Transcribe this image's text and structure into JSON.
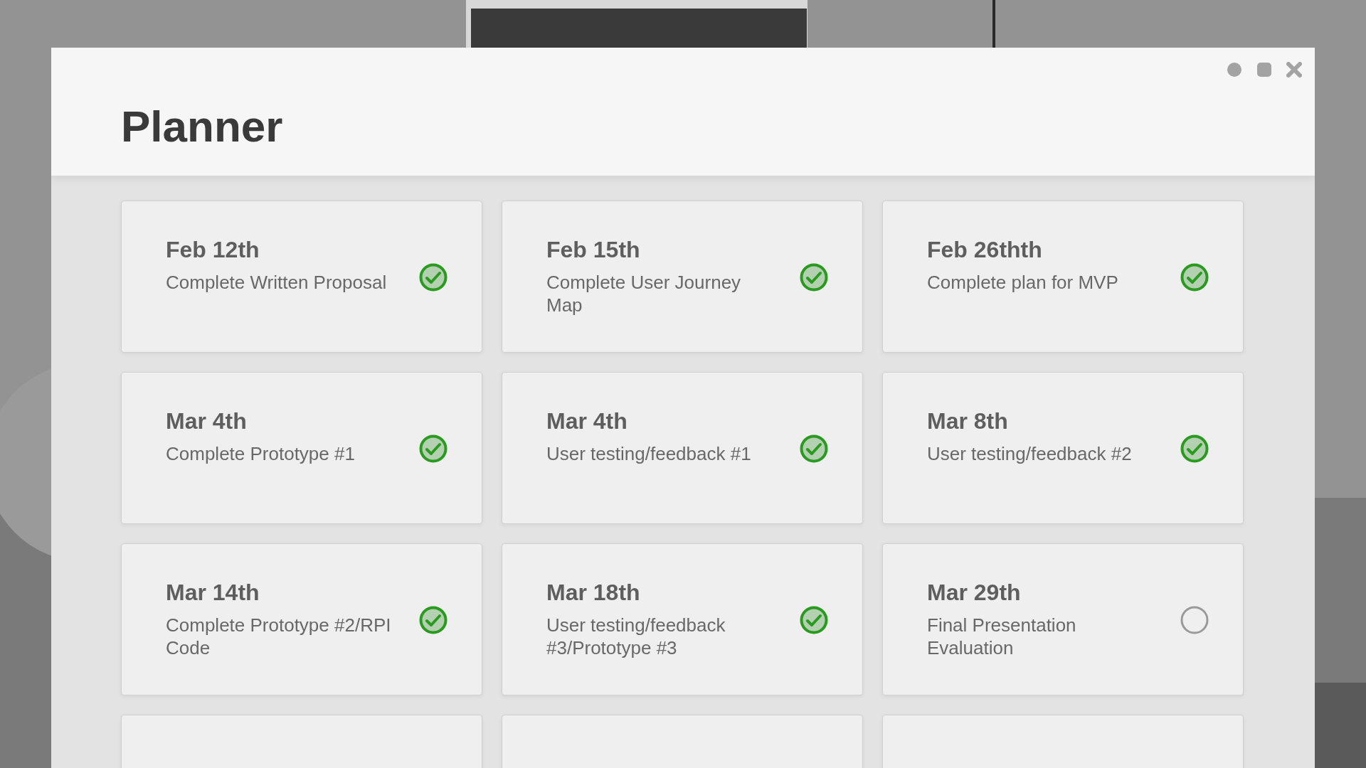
{
  "window": {
    "title": "Planner",
    "controls": [
      {
        "kind": "minimize"
      },
      {
        "kind": "maximize"
      },
      {
        "kind": "close"
      }
    ]
  },
  "tasks": [
    {
      "kind": "task",
      "date": "Feb 12th",
      "description": "Complete Written Proposal",
      "checked": true
    },
    {
      "kind": "task",
      "date": "Feb 15th",
      "description": "Complete User Journey Map",
      "checked": true
    },
    {
      "kind": "task",
      "date": "Feb 26thth",
      "description": "Complete plan for MVP",
      "checked": true
    },
    {
      "kind": "task",
      "date": "Mar 4th",
      "description": "Complete Prototype #1",
      "checked": true
    },
    {
      "kind": "task",
      "date": "Mar 4th",
      "description": "User testing/feedback #1",
      "checked": true
    },
    {
      "kind": "task",
      "date": "Mar 8th",
      "description": "User testing/feedback #2",
      "checked": true
    },
    {
      "kind": "task",
      "date": "Mar 14th",
      "description": "Complete Prototype #2/RPI Code",
      "checked": true
    },
    {
      "kind": "task",
      "date": "Mar 18th",
      "description": "User testing/feedback #3/Prototype #3",
      "checked": true
    },
    {
      "kind": "task",
      "date": "Mar 29th",
      "description": "Final Presentation Evaluation",
      "checked": false
    },
    {
      "kind": "blank"
    },
    {
      "kind": "blank"
    },
    {
      "kind": "blank"
    }
  ]
}
